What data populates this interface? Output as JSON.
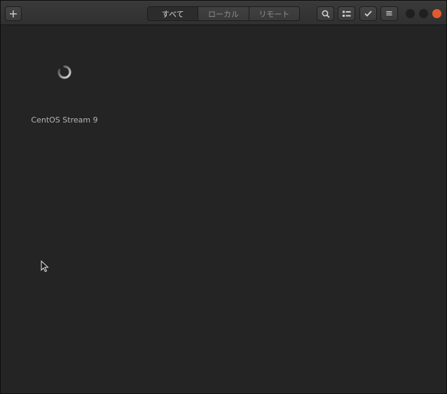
{
  "headerbar": {
    "add_label": "+",
    "tabs": [
      {
        "label": "すべて",
        "active": true
      },
      {
        "label": "ローカル",
        "active": false
      },
      {
        "label": "リモート",
        "active": false
      }
    ],
    "search_icon": "search-icon",
    "selection_icon": "selection-mode-icon",
    "check_icon": "check-icon",
    "menu_label": "≡"
  },
  "colors": {
    "close_button": "#e25b2f",
    "background": "#242424",
    "header": "#353535"
  },
  "machines": [
    {
      "name": "CentOS Stream 9",
      "status": "loading"
    }
  ]
}
